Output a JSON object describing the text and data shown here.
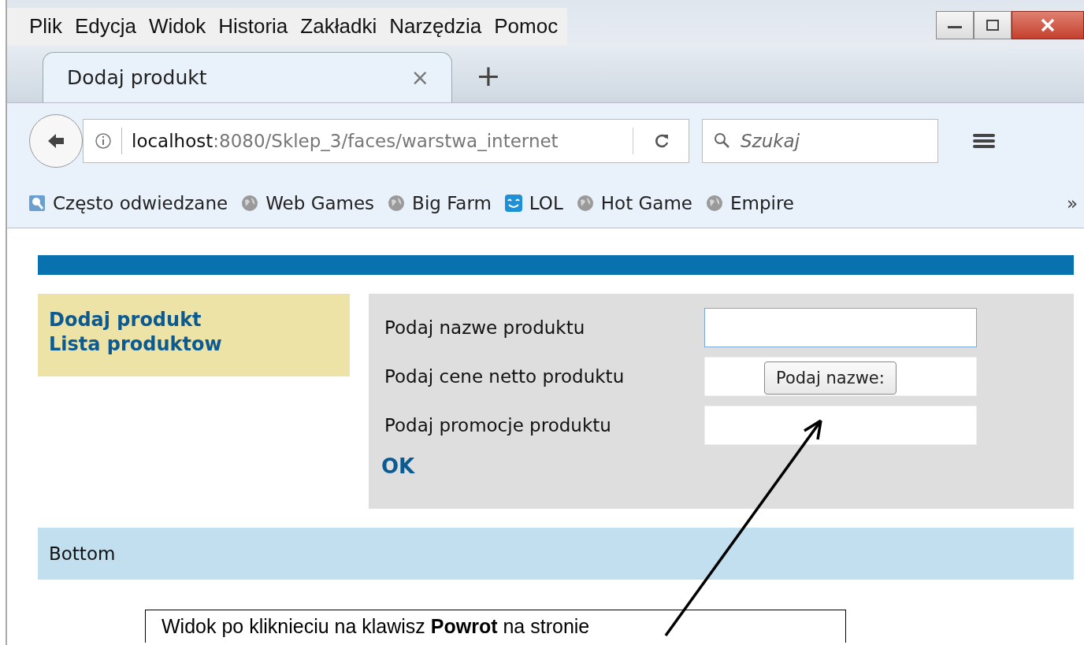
{
  "menu": [
    "Plik",
    "Edycja",
    "Widok",
    "Historia",
    "Zakładki",
    "Narzędzia",
    "Pomoc"
  ],
  "tabs": [
    {
      "label": "Dodaj produkt",
      "selected": true,
      "close": "×"
    }
  ],
  "new_tab": "+",
  "address": {
    "host": "localhost",
    "path": ":8080/Sklep_3/faces/warstwa_internet"
  },
  "search": {
    "placeholder": "Szukaj"
  },
  "bookmarks": [
    {
      "label": "Często odwiedzane",
      "kind": "folder"
    },
    {
      "label": "Web Games",
      "kind": "globe"
    },
    {
      "label": "Big Farm",
      "kind": "globe"
    },
    {
      "label": "LOL",
      "kind": "smile"
    },
    {
      "label": "Hot Game",
      "kind": "globe"
    },
    {
      "label": "Empire",
      "kind": "globe"
    }
  ],
  "bookmarks_more": "»",
  "sidebar": {
    "links": [
      "Dodaj produkt",
      "Lista produktow"
    ]
  },
  "form": {
    "fields": [
      {
        "label": "Podaj nazwe produktu",
        "focused": true
      },
      {
        "label": "Podaj cene netto produktu",
        "focused": false
      },
      {
        "label": "Podaj promocje produktu",
        "focused": false
      }
    ],
    "submit": "OK",
    "tooltip": "Podaj nazwe:"
  },
  "footer": "Bottom",
  "callout": "Widok po kliknieciu na klawisz **Powrot** na stronie"
}
